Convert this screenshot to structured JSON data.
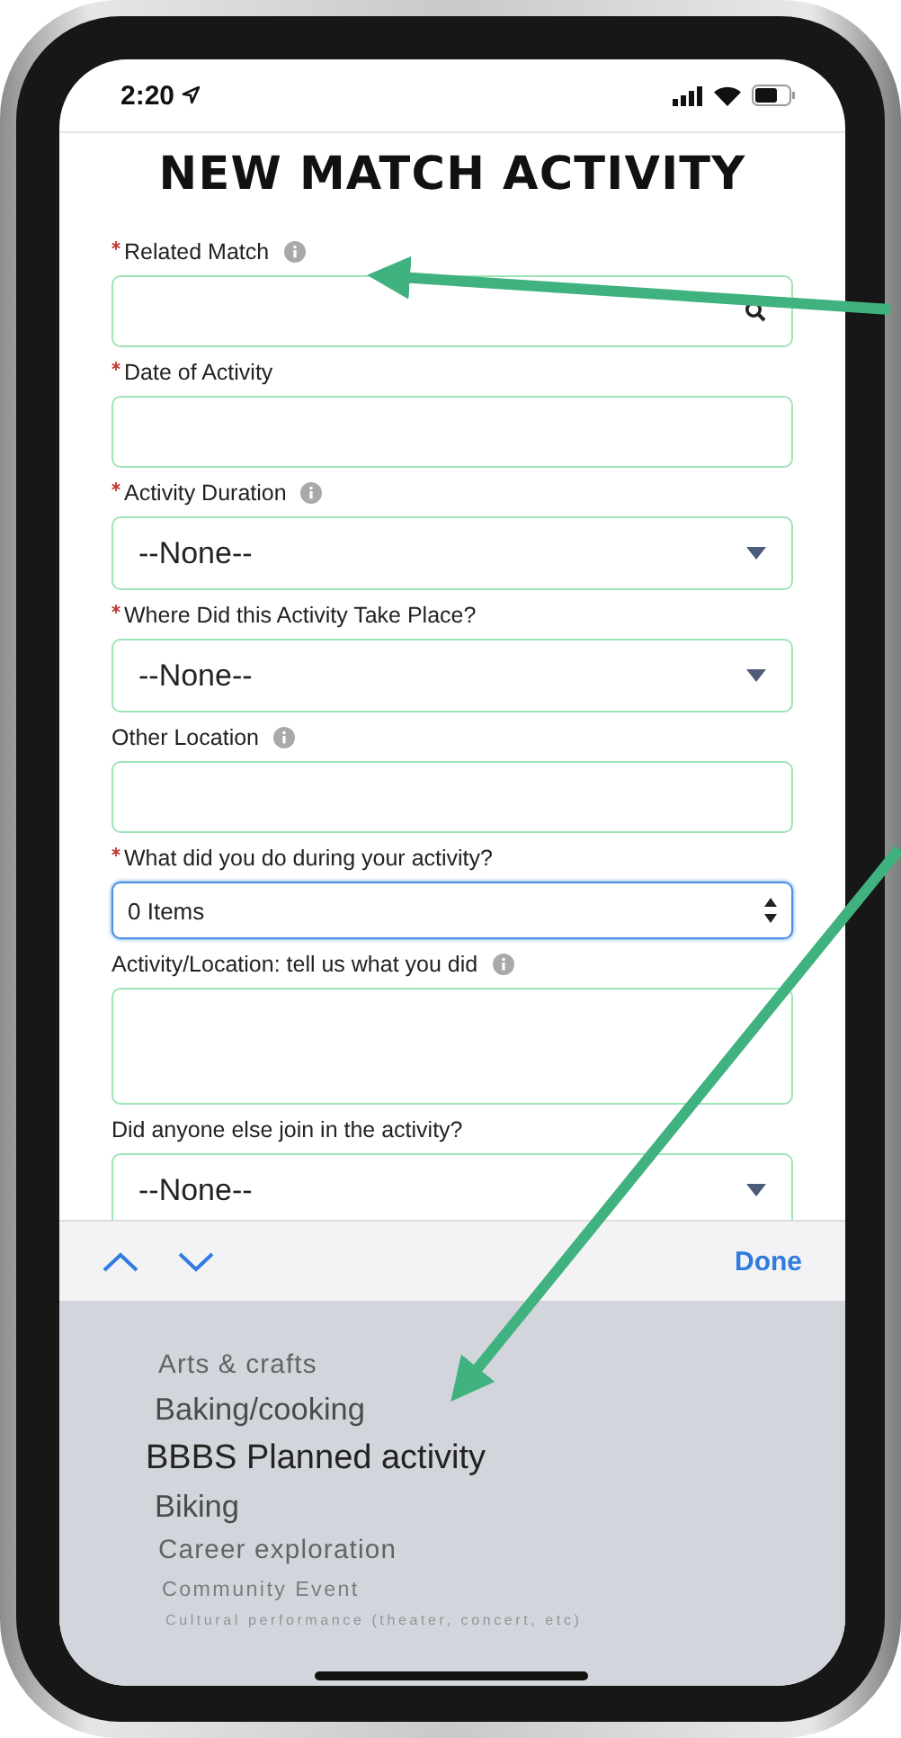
{
  "status_bar": {
    "time": "2:20"
  },
  "title": "NEW MATCH ACTIVITY",
  "fields": [
    {
      "kind": "lookup",
      "label": "Related Match",
      "required": true,
      "info": true
    },
    {
      "kind": "text",
      "label": "Date of Activity",
      "required": true,
      "info": false
    },
    {
      "kind": "select",
      "label": "Activity Duration",
      "required": true,
      "info": true,
      "value": "--None--"
    },
    {
      "kind": "select",
      "label": "Where Did this Activity Take Place?",
      "required": true,
      "info": false,
      "value": "--None--"
    },
    {
      "kind": "text",
      "label": "Other Location",
      "required": false,
      "info": true
    },
    {
      "kind": "multiselect",
      "label": "What did you do during your activity?",
      "required": true,
      "info": false,
      "value": "0 Items",
      "focused": true
    },
    {
      "kind": "textarea",
      "label": "Activity/Location: tell us what you did",
      "required": false,
      "info": true
    },
    {
      "kind": "select",
      "label": "Did anyone else join in the activity?",
      "required": false,
      "info": false,
      "value": "--None--"
    }
  ],
  "keyboard_toolbar": {
    "done": "Done"
  },
  "picker": [
    {
      "label": "Arts & crafts",
      "selected": false
    },
    {
      "label": "Baking/cooking",
      "selected": false
    },
    {
      "label": "BBBS Planned activity",
      "selected": true
    },
    {
      "label": "Biking",
      "selected": false
    },
    {
      "label": "Career exploration",
      "selected": false
    },
    {
      "label": "Community Event",
      "selected": false
    },
    {
      "label": "Cultural performance (theater, concert, etc)",
      "selected": false
    }
  ]
}
